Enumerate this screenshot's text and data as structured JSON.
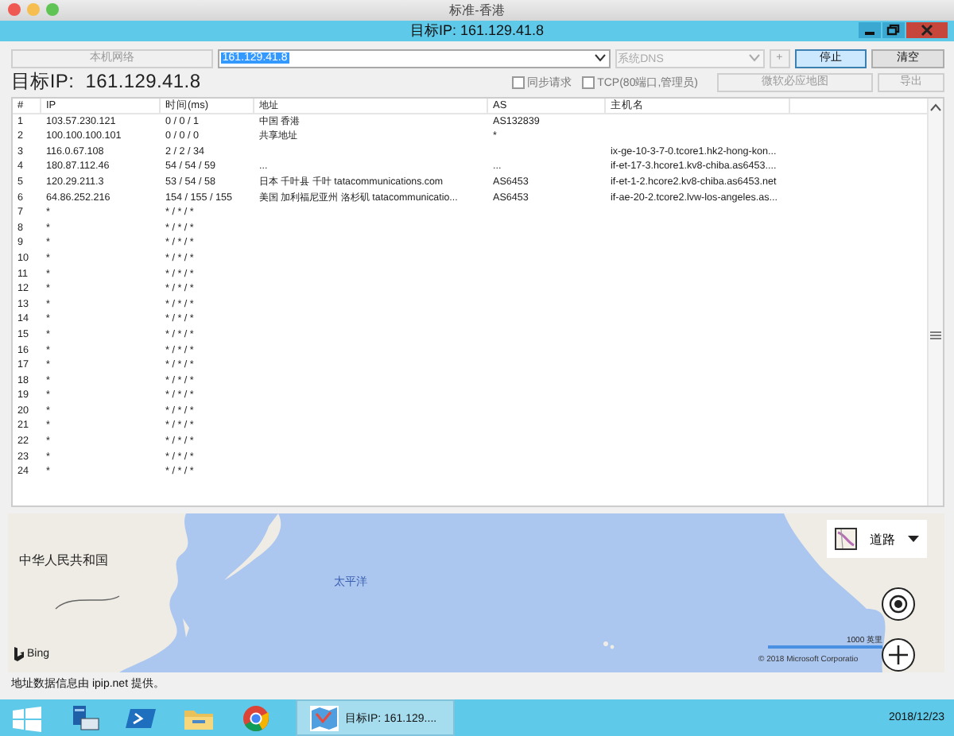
{
  "window": {
    "title": "标准-香港"
  },
  "app_bar": {
    "title": "目标IP: 161.129.41.8"
  },
  "toolbar": {
    "network_button": {
      "label": "本机网络",
      "disabled": true
    },
    "target_field": {
      "value": "161.129.41.8"
    },
    "dns_select": {
      "value": "系统DNS",
      "disabled": true
    },
    "add_button": {
      "label": "+",
      "disabled": true
    },
    "stop_button": {
      "label": "停止",
      "selected": true
    },
    "clear_button": {
      "label": "清空"
    }
  },
  "heading": "目标IP:  161.129.41.8",
  "options": [
    {
      "label": "同步请求",
      "checked": false
    },
    {
      "label": "TCP(80端口,管理员)",
      "checked": false
    }
  ],
  "actions": [
    {
      "label": "微软必应地图",
      "disabled": true
    },
    {
      "label": "导出",
      "disabled": true
    }
  ],
  "table": {
    "columns": [
      "#",
      "IP",
      "时间(ms)",
      "地址",
      "AS",
      "主机名"
    ],
    "rows": [
      [
        "1",
        "103.57.230.121",
        "0 / 0 / 1",
        "中国 香港",
        "AS132839",
        ""
      ],
      [
        "2",
        "100.100.100.101",
        "0 / 0 / 0",
        "共享地址",
        "*",
        ""
      ],
      [
        "3",
        "116.0.67.108",
        "2 / 2 / 34",
        "",
        "",
        "ix-ge-10-3-7-0.tcore1.hk2-hong-kon..."
      ],
      [
        "4",
        "180.87.112.46",
        "54 / 54 / 59",
        "...",
        "...",
        "if-et-17-3.hcore1.kv8-chiba.as6453...."
      ],
      [
        "5",
        "120.29.211.3",
        "53 / 54 / 58",
        "日本 千叶县 千叶 tatacommunications.com",
        "AS6453",
        "if-et-1-2.hcore2.kv8-chiba.as6453.net"
      ],
      [
        "6",
        "64.86.252.216",
        "154 / 155 / 155",
        "美国 加利福尼亚州 洛杉矶 tatacommunicatio...",
        "AS6453",
        "if-ae-20-2.tcore2.lvw-los-angeles.as..."
      ],
      [
        "7",
        "*",
        "* / * / *",
        "",
        "",
        ""
      ],
      [
        "8",
        "*",
        "* / * / *",
        "",
        "",
        ""
      ],
      [
        "9",
        "*",
        "* / * / *",
        "",
        "",
        ""
      ],
      [
        "10",
        "*",
        "* / * / *",
        "",
        "",
        ""
      ],
      [
        "11",
        "*",
        "* / * / *",
        "",
        "",
        ""
      ],
      [
        "12",
        "*",
        "* / * / *",
        "",
        "",
        ""
      ],
      [
        "13",
        "*",
        "* / * / *",
        "",
        "",
        ""
      ],
      [
        "14",
        "*",
        "* / * / *",
        "",
        "",
        ""
      ],
      [
        "15",
        "*",
        "* / * / *",
        "",
        "",
        ""
      ],
      [
        "16",
        "*",
        "* / * / *",
        "",
        "",
        ""
      ],
      [
        "17",
        "*",
        "* / * / *",
        "",
        "",
        ""
      ],
      [
        "18",
        "*",
        "* / * / *",
        "",
        "",
        ""
      ],
      [
        "19",
        "*",
        "* / * / *",
        "",
        "",
        ""
      ],
      [
        "20",
        "*",
        "* / * / *",
        "",
        "",
        ""
      ],
      [
        "21",
        "*",
        "* / * / *",
        "",
        "",
        ""
      ],
      [
        "22",
        "*",
        "* / * / *",
        "",
        "",
        ""
      ],
      [
        "23",
        "*",
        "* / * / *",
        "",
        "",
        ""
      ],
      [
        "24",
        "*",
        "* / * / *",
        "",
        "",
        ""
      ]
    ]
  },
  "map": {
    "labels": [
      {
        "kind": "country",
        "text": "中华人民共和国"
      },
      {
        "kind": "ocean",
        "text": "太平洋"
      }
    ],
    "layer_button": {
      "label": "道路"
    },
    "logo": "Bing",
    "scale": "1000 英里",
    "copyright": "© 2018 Microsoft Corporatio"
  },
  "footer": "地址数据信息由 ipip.net 提供。",
  "taskbar": {
    "active_app": "目标IP: 161.129....",
    "date": "2018/12/23"
  }
}
